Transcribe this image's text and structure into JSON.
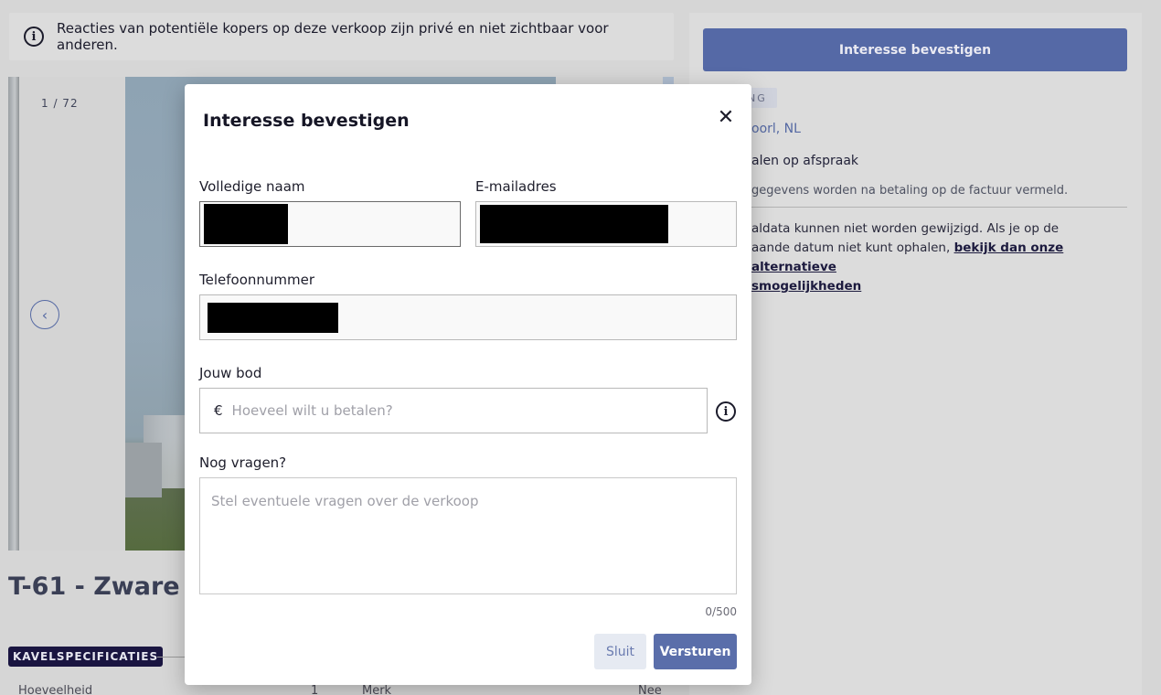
{
  "notice": {
    "text": "Reacties van potentiële kopers op deze verkoop zijn privé en niet zichtbaar voor anderen.",
    "icon": "info-icon"
  },
  "gallery": {
    "counter": "1 / 72",
    "prev_icon": "chevron-left-icon"
  },
  "lot": {
    "title": "T-61 - Zware G",
    "spec_badge": "KAVELSPECIFICATIES",
    "row_left": "Hoeveelheid",
    "row_qty": "1",
    "row_mid": "Merk",
    "row_right": "Nee"
  },
  "sidebar": {
    "confirm_button": "Interesse bevestigen",
    "tag": "NG",
    "location": "oorl, NL",
    "pickup": "alen op afspraak",
    "invoice_note": "gegevens worden na betaling op de factuur vermeld.",
    "note_line1": "aldata kunnen niet worden gewijzigd. Als je op de",
    "note_line2": "aande datum niet kunt ophalen,",
    "note_link1": "bekijk dan onze alternatieve",
    "note_link2": "smogelijkheden"
  },
  "modal": {
    "title": "Interesse bevestigen",
    "close_icon": "close-icon",
    "name_label": "Volledige naam",
    "email_label": "E-mailadres",
    "phone_label": "Telefoonnummer",
    "bid_label": "Jouw bod",
    "currency": "€",
    "bid_placeholder": "Hoeveel wilt u betalen?",
    "questions_label": "Nog vragen?",
    "questions_placeholder": "Stel eventuele vragen over de verkoop",
    "char_count": "0/500",
    "close_button": "Sluit",
    "send_button": "Versturen"
  },
  "colors": {
    "primary": "#5a6eaa",
    "badge_dark": "#1a1541",
    "link": "#5569a3"
  }
}
